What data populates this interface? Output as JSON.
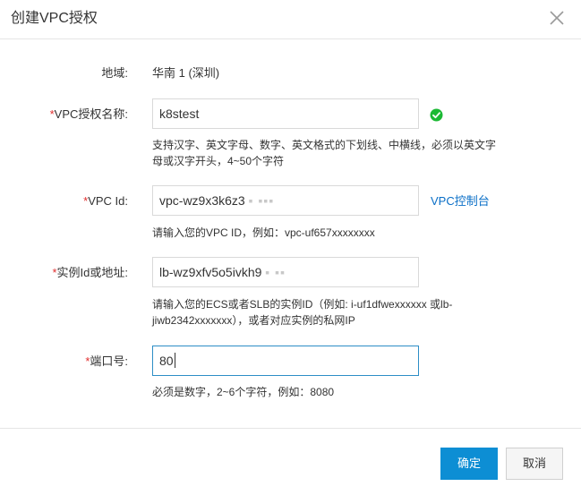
{
  "dialog": {
    "title": "创建VPC授权",
    "close_icon": "close-icon"
  },
  "form": {
    "region": {
      "label": "地域:",
      "value": "华南 1 (深圳)"
    },
    "vpc_auth_name": {
      "required_mark": "*",
      "label": "VPC授权名称:",
      "value": "k8stest",
      "valid_icon": "check-circle-icon",
      "valid_color": "#1bb934",
      "hint": "支持汉字、英文字母、数字、英文格式的下划线、中横线，必须以英文字母或汉字开头，4~50个字符"
    },
    "vpc_id": {
      "required_mark": "*",
      "label": "VPC Id:",
      "value": "vpc-wz9x3k6z3",
      "masked_suffix": "▪ ▪▪▪",
      "link": "VPC控制台",
      "hint": "请输入您的VPC ID，例如：vpc-uf657xxxxxxxx"
    },
    "instance": {
      "required_mark": "*",
      "label": "实例Id或地址:",
      "value": "lb-wz9xfv5o5ivkh9",
      "masked_suffix": "▪ ▪▪",
      "hint": "请输入您的ECS或者SLB的实例ID（例如: i-uf1dfwexxxxxx 或lb-jiwb2342xxxxxxx），或者对应实例的私网IP"
    },
    "port": {
      "required_mark": "*",
      "label": "端口号:",
      "value": "80",
      "hint": "必须是数字，2~6个字符，例如：8080"
    }
  },
  "footer": {
    "confirm_label": "确定",
    "cancel_label": "取消"
  },
  "colors": {
    "primary": "#0d8ed4",
    "link": "#0a6fc7",
    "required": "#e02d2d",
    "focus_border": "#2d8ec6"
  }
}
